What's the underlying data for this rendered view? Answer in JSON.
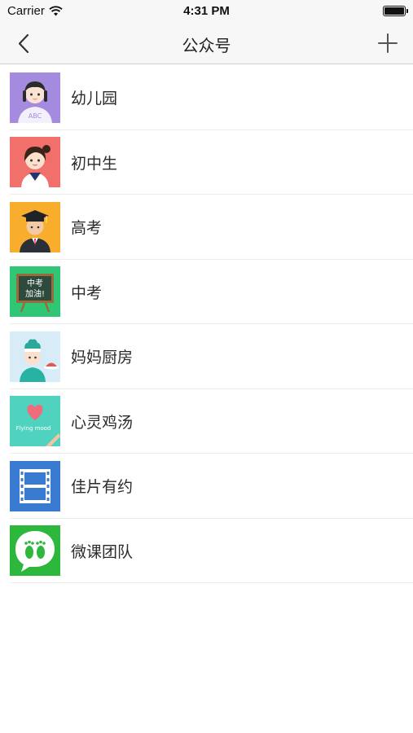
{
  "status_bar": {
    "carrier": "Carrier",
    "time": "4:31 PM",
    "icons": [
      "wifi-icon",
      "battery-icon"
    ]
  },
  "nav": {
    "title": "公众号",
    "back_icon": "chevron-left-icon",
    "add_icon": "plus-icon"
  },
  "accounts": [
    {
      "name": "幼儿园",
      "icon": "kindergarten-girl-avatar",
      "color": "#a48be0",
      "badge_text": "ABC"
    },
    {
      "name": "初中生",
      "icon": "middle-school-girl-avatar",
      "color": "#f2706b"
    },
    {
      "name": "高考",
      "icon": "graduate-avatar",
      "color": "#f8ad2c"
    },
    {
      "name": "中考",
      "icon": "chalkboard-avatar",
      "color": "#2fc776",
      "board_lines": [
        "中考",
        "加油!"
      ]
    },
    {
      "name": "妈妈厨房",
      "icon": "chef-avatar",
      "color": "#d8ecf7"
    },
    {
      "name": "心灵鸡汤",
      "icon": "heart-avatar",
      "color": "#4fd3bf",
      "badge_text": "Flying mood"
    },
    {
      "name": "佳片有约",
      "icon": "film-strip-avatar",
      "color": "#3a7bd2"
    },
    {
      "name": "微课团队",
      "icon": "footprints-avatar",
      "color": "#2db83d"
    }
  ]
}
